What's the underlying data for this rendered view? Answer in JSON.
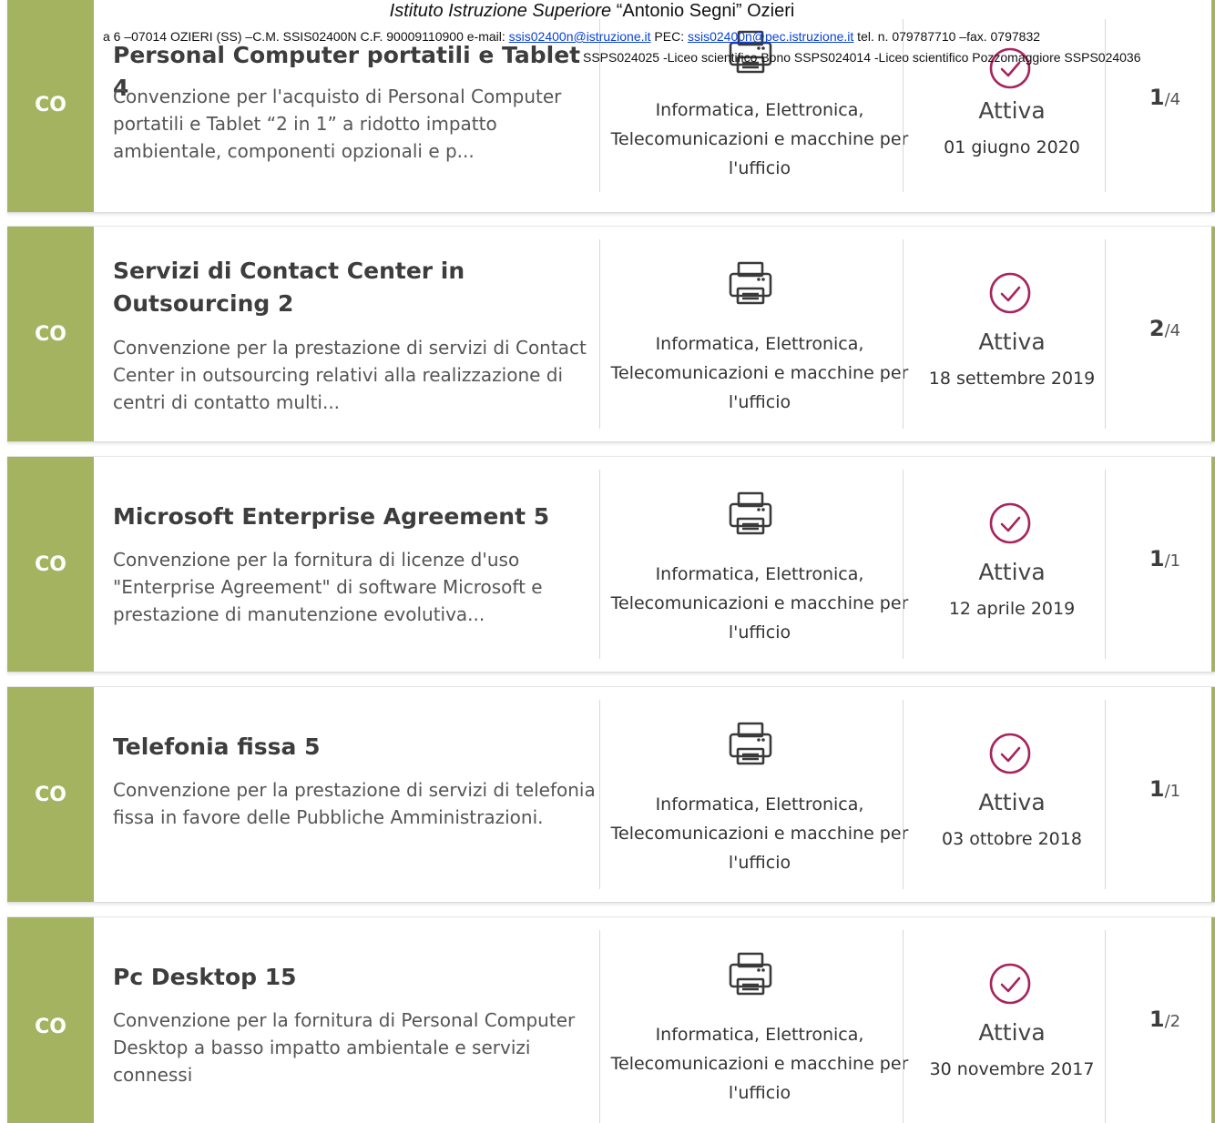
{
  "letterhead": {
    "school_italic": "Istituto Istruzione Superiore",
    "school_name": "“Antonio Segni” Ozieri",
    "address_lead": "a 6 –07014 OZIERI (SS) –C.M. SSIS02400N  C.F. 90009110900 e-mail: ",
    "email": "ssis02400n@istruzione.it",
    "pec_label": " PEC: ",
    "pec": "ssis02400n@pec.istruzione.it",
    "phones": " tel. n. 079787710 –fax. 0797832",
    "school_codes": "SSPS024025 -Liceo scientifico Bono SSPS024014 -Liceo scientifico Pozzomaggiore SSPS024036"
  },
  "cards": [
    {
      "tag": "CO",
      "title": "Personal Computer portatili e Tablet 4",
      "description": "Convenzione per l'acquisto di Personal Computer portatili e Tablet “2 in 1” a ridotto impatto ambientale, componenti opzionali e p...",
      "category_icon": "printer-icon",
      "category": "Informatica, Elettronica, Telecomunicazioni e macchine per l'ufficio",
      "status_icon": "check-circle-icon",
      "status": "Attiva",
      "date": "01 giugno 2020",
      "count_current": "1",
      "count_total": "/4"
    },
    {
      "tag": "CO",
      "title": "Servizi di Contact Center in Outsourcing 2",
      "description": "Convenzione per la prestazione di servizi di Contact Center in outsourcing relativi alla realizzazione di centri di contatto multi...",
      "category_icon": "printer-icon",
      "category": "Informatica, Elettronica, Telecomunicazioni e macchine per l'ufficio",
      "status_icon": "check-circle-icon",
      "status": "Attiva",
      "date": "18 settembre 2019",
      "count_current": "2",
      "count_total": "/4"
    },
    {
      "tag": "CO",
      "title": "Microsoft Enterprise Agreement 5",
      "description": "Convenzione per la fornitura di licenze d'uso \"Enterprise Agreement\" di software Microsoft e prestazione di manutenzione evolutiva...",
      "category_icon": "printer-icon",
      "category": "Informatica, Elettronica, Telecomunicazioni e macchine per l'ufficio",
      "status_icon": "check-circle-icon",
      "status": "Attiva",
      "date": "12 aprile 2019",
      "count_current": "1",
      "count_total": "/1"
    },
    {
      "tag": "CO",
      "title": "Telefonia fissa 5",
      "description": "Convenzione per la prestazione di servizi di telefonia fissa in favore delle Pubbliche Amministrazioni.",
      "category_icon": "printer-icon",
      "category": "Informatica, Elettronica, Telecomunicazioni e macchine per l'ufficio",
      "status_icon": "check-circle-icon",
      "status": "Attiva",
      "date": "03 ottobre 2018",
      "count_current": "1",
      "count_total": "/1"
    },
    {
      "tag": "CO",
      "title": "Pc Desktop 15",
      "description": "Convenzione per la fornitura di Personal Computer Desktop a basso impatto ambientale e servizi connessi",
      "category_icon": "printer-icon",
      "category": "Informatica, Elettronica, Telecomunicazioni e macchine per l'ufficio",
      "status_icon": "check-circle-icon",
      "status": "Attiva",
      "date": "30 novembre 2017",
      "count_current": "1",
      "count_total": "/2"
    }
  ],
  "colors": {
    "accent": "#a4b35f",
    "status_icon": "#a8245e",
    "link": "#0b43d6"
  }
}
